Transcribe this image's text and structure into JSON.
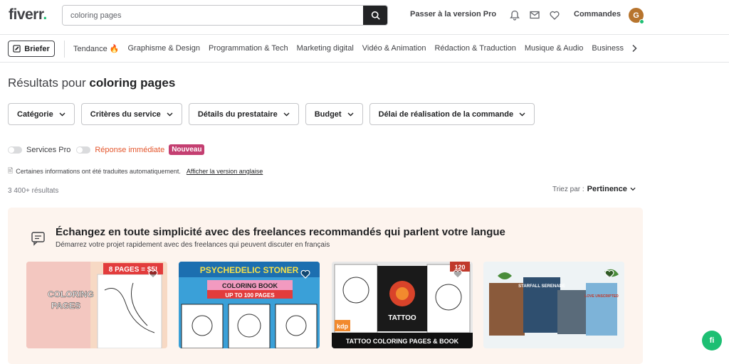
{
  "header": {
    "logo": "fiverr",
    "logo_dot": ".",
    "search": {
      "value": "coloring pages",
      "placeholder": ""
    },
    "pro_link": "Passer à la version Pro",
    "orders": "Commandes",
    "avatar_initial": "G"
  },
  "catbar": {
    "briefer": "Briefer",
    "items": [
      {
        "label": "Tendance",
        "icon": "fire-icon"
      },
      {
        "label": "Graphisme & Design"
      },
      {
        "label": "Programmation & Tech"
      },
      {
        "label": "Marketing digital"
      },
      {
        "label": "Vidéo & Animation"
      },
      {
        "label": "Rédaction & Traduction"
      },
      {
        "label": "Musique & Audio"
      },
      {
        "label": "Business"
      }
    ]
  },
  "results": {
    "prefix": "Résultats pour",
    "query": "coloring pages",
    "count": "3 400+ résultats",
    "sort_label": "Triez par :",
    "sort_value": "Pertinence"
  },
  "filters": [
    "Catégorie",
    "Critères du service",
    "Détails du prestataire",
    "Budget",
    "Délai de réalisation de la commande"
  ],
  "toggles": {
    "pro": "Services Pro",
    "instant": "Réponse immédiate",
    "new_badge": "Nouveau"
  },
  "translation": {
    "note": "Certaines informations ont été traduites automatiquement.",
    "link": "Afficher la version anglaise"
  },
  "banner": {
    "title": "Échangez en toute simplicité avec des freelances recommandés qui parlent votre langue",
    "subtitle": "Démarrez votre projet rapidement avec des freelances qui peuvent discuter en français"
  },
  "cards": [
    {
      "image_text_top": "8 PAGES = $5!",
      "image_text_main": "I will draw COLORING PAGES",
      "bg": "#f7d9c4"
    },
    {
      "image_text_top": "PSYCHEDELIC STONER",
      "image_text_main": "COLORING BOOK UP TO 100 PAGES",
      "bg": "#3aa0d8"
    },
    {
      "image_text_top": "TATTOO",
      "image_text_main": "TATTOO COLORING PAGES & BOOK",
      "badge": "120",
      "bg": "#2a2a2a"
    },
    {
      "image_text_top": "STARFALL SERENADE",
      "image_text_main": "LOVE UNSCRIPTED",
      "bg": "#eef3f5"
    }
  ],
  "colors": {
    "accent": "#1dbf73",
    "new_badge": "#c43f71",
    "banner_bg": "#fdf4ee"
  }
}
